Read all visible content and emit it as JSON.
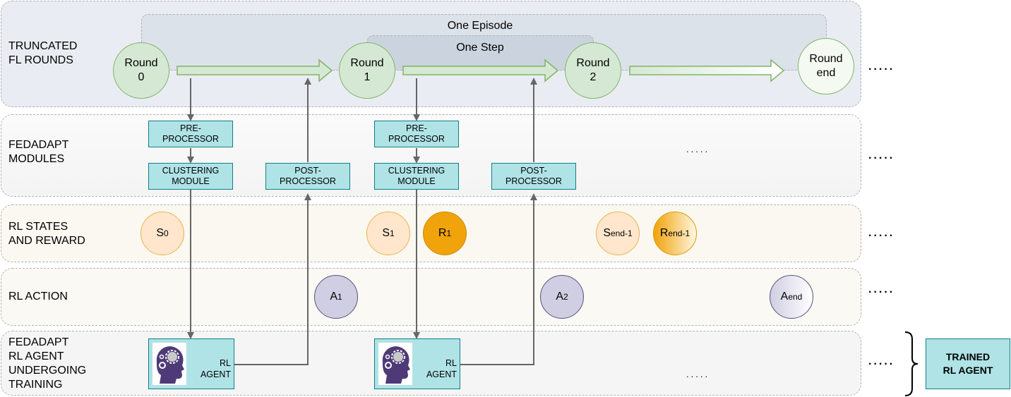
{
  "lanes": [
    {
      "id": "fl-rounds",
      "label": "TRUNCATED\nFL ROUNDS",
      "fill": "#e9edf3"
    },
    {
      "id": "modules",
      "label": "FEDADAPT\nMODULES",
      "fill": "#f7f7f7"
    },
    {
      "id": "states",
      "label": "RL STATES\nAND REWARD",
      "fill": "#fbf8f1"
    },
    {
      "id": "action",
      "label": "RL ACTION",
      "fill": "#fbf9f3"
    },
    {
      "id": "agent",
      "label": "FEDADAPT\nRL AGENT\nUNDERGOING\nTRAINING",
      "fill": "#f5f5f5"
    }
  ],
  "groups": {
    "episode": "One Episode",
    "step": "One Step"
  },
  "rounds": [
    {
      "label": "Round\n0"
    },
    {
      "label": "Round\n1"
    },
    {
      "label": "Round\n2"
    },
    {
      "label": "Round\nend"
    }
  ],
  "modules": {
    "pre_processor": "PRE-\nPROCESSOR",
    "clustering": "CLUSTERING\nMODULE",
    "post_processor": "POST-\nPROCESSOR"
  },
  "states": [
    {
      "base": "S",
      "sub": "0"
    },
    {
      "base": "S",
      "sub": "1"
    },
    {
      "base": "S",
      "sub": "end-1"
    }
  ],
  "rewards": [
    {
      "base": "R",
      "sub": "1"
    },
    {
      "base": "R",
      "sub": "end-1"
    }
  ],
  "actions": [
    {
      "base": "A",
      "sub": "1"
    },
    {
      "base": "A",
      "sub": "2"
    },
    {
      "base": "A",
      "sub": "end"
    }
  ],
  "agent": {
    "label": "RL\nAGENT",
    "icon": "brain-gears-head-icon"
  },
  "trained_agent": "TRAINED\nRL AGENT",
  "ellipsis": "....."
}
